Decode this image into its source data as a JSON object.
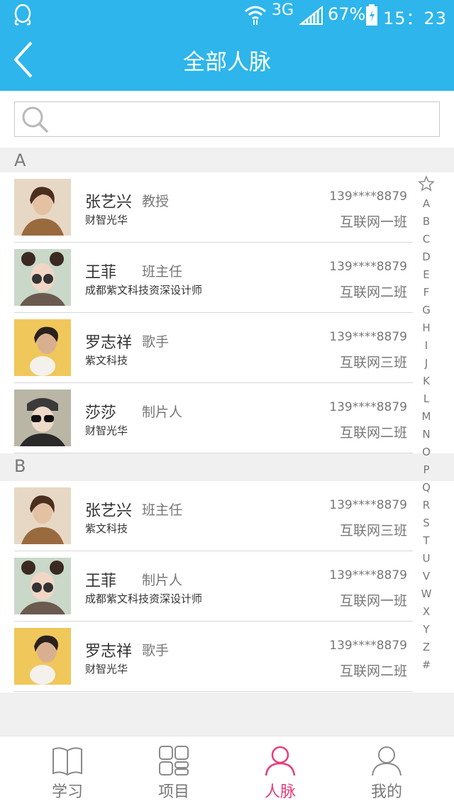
{
  "status_bar": {
    "network": "3G",
    "battery": "67%",
    "time": "15：23"
  },
  "header": {
    "title": "全部人脉"
  },
  "search": {
    "value": "",
    "placeholder": ""
  },
  "sections": [
    {
      "letter": "A"
    },
    {
      "letter": "B"
    }
  ],
  "contacts_a": [
    {
      "name": "张艺兴",
      "role": "教授",
      "org": "财智光华",
      "phone": "139****8879",
      "class": "互联网一班",
      "avatar": "avatar-man"
    },
    {
      "name": "王菲",
      "role": "班主任",
      "org": "成都紫文科技资深设计师",
      "phone": "139****8879",
      "class": "互联网二班",
      "avatar": "avatar-woman-glasses"
    },
    {
      "name": "罗志祥",
      "role": "歌手",
      "org": "紫文科技",
      "phone": "139****8879",
      "class": "互联网三班",
      "avatar": "avatar-man-cat"
    },
    {
      "name": "莎莎",
      "role": "制片人",
      "org": "财智光华",
      "phone": "139****8879",
      "class": "互联网二班",
      "avatar": "avatar-woman-sunglasses"
    }
  ],
  "contacts_b": [
    {
      "name": "张艺兴",
      "role": "班主任",
      "org": "紫文科技",
      "phone": "139****8879",
      "class": "互联网三班",
      "avatar": "avatar-man"
    },
    {
      "name": "王菲",
      "role": "制片人",
      "org": "成都紫文科技资深设计师",
      "phone": "139****8879",
      "class": "互联网一班",
      "avatar": "avatar-woman-glasses"
    },
    {
      "name": "罗志祥",
      "role": "歌手",
      "org": "财智光华",
      "phone": "139****8879",
      "class": "互联网二班",
      "avatar": "avatar-man-cat"
    }
  ],
  "index_letters": [
    "A",
    "B",
    "C",
    "D",
    "E",
    "F",
    "G",
    "H",
    "I",
    "J",
    "K",
    "L",
    "M",
    "N",
    "O",
    "P",
    "Q",
    "R",
    "S",
    "T",
    "U",
    "V",
    "W",
    "X",
    "Y",
    "Z",
    "#"
  ],
  "tabs": [
    {
      "label": "学习",
      "icon": "book-icon"
    },
    {
      "label": "项目",
      "icon": "grid-icon"
    },
    {
      "label": "人脉",
      "icon": "person-icon",
      "active": true
    },
    {
      "label": "我的",
      "icon": "profile-icon"
    }
  ],
  "colors": {
    "primary": "#2db5ec",
    "active_tab": "#e83e7b"
  }
}
